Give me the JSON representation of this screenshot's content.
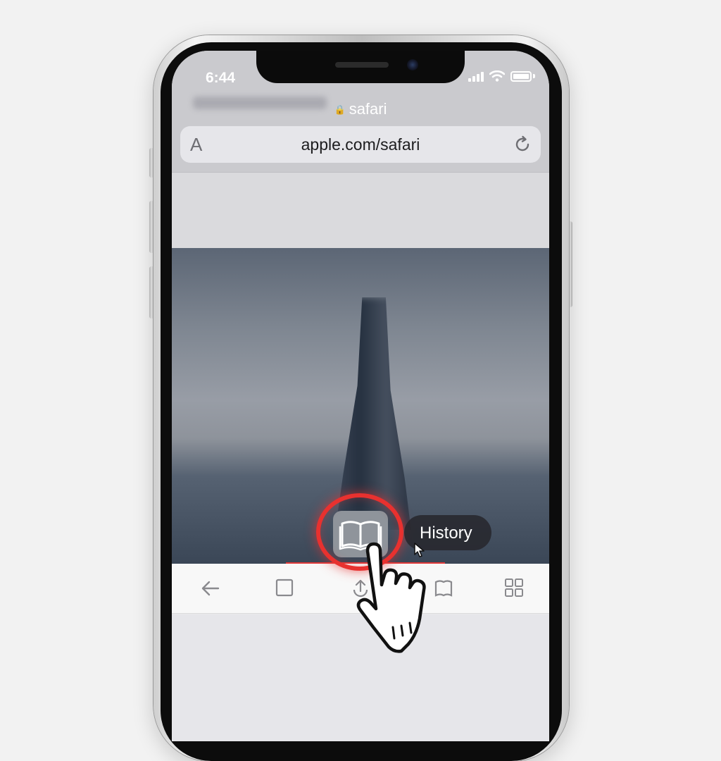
{
  "status_bar": {
    "time": "6:44"
  },
  "browser": {
    "site_name": "safari",
    "url_bar": {
      "text_size_label": "A",
      "url": "apple.com/safari"
    }
  },
  "tooltip": {
    "label": "History"
  },
  "icons": {
    "lock": "lock-icon",
    "reload": "reload-icon",
    "back": "back-arrow-icon",
    "square": "square-icon",
    "share": "share-icon",
    "bookmarks": "book-icon",
    "tabs": "tabs-icon",
    "cursor": "hand-cursor-icon"
  },
  "colors": {
    "highlight": "#e8312f"
  }
}
